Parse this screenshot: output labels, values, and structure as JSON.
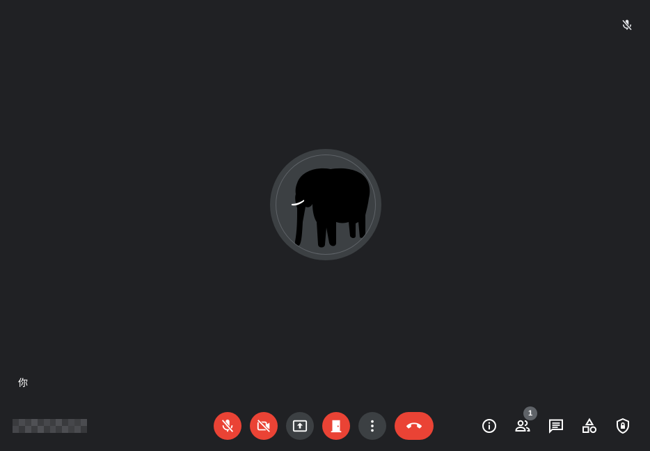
{
  "self_tile": {
    "name_label": "你",
    "mic_state_icon": "mic-off-icon",
    "avatar_icon": "elephant-avatar-icon"
  },
  "meeting_info": {
    "code_icon": "pixelated-meeting-code"
  },
  "controls": [
    {
      "name": "microphone-toggle-button",
      "icon": "mic-off-icon",
      "state": "off",
      "color": "#ea4335"
    },
    {
      "name": "camera-toggle-button",
      "icon": "videocam-off-icon",
      "state": "off",
      "color": "#ea4335"
    },
    {
      "name": "present-screen-button",
      "icon": "present-to-all-icon",
      "color": "#3c4043"
    },
    {
      "name": "leave-room-button",
      "icon": "door-icon",
      "color": "#ea4335"
    },
    {
      "name": "more-options-button",
      "icon": "more-vert-icon",
      "color": "#3c4043"
    },
    {
      "name": "hang-up-button",
      "icon": "call-end-icon",
      "color": "#ea4335"
    }
  ],
  "side_controls": [
    {
      "name": "meeting-details-button",
      "icon": "info-icon"
    },
    {
      "name": "people-button",
      "icon": "people-icon",
      "badge": "1"
    },
    {
      "name": "chat-button",
      "icon": "chat-icon"
    },
    {
      "name": "activities-button",
      "icon": "shapes-icon"
    },
    {
      "name": "host-controls-button",
      "icon": "shield-lock-icon"
    }
  ],
  "colors": {
    "background": "#202124",
    "surface": "#3c4043",
    "danger": "#ea4335",
    "icon": "#ffffff"
  }
}
